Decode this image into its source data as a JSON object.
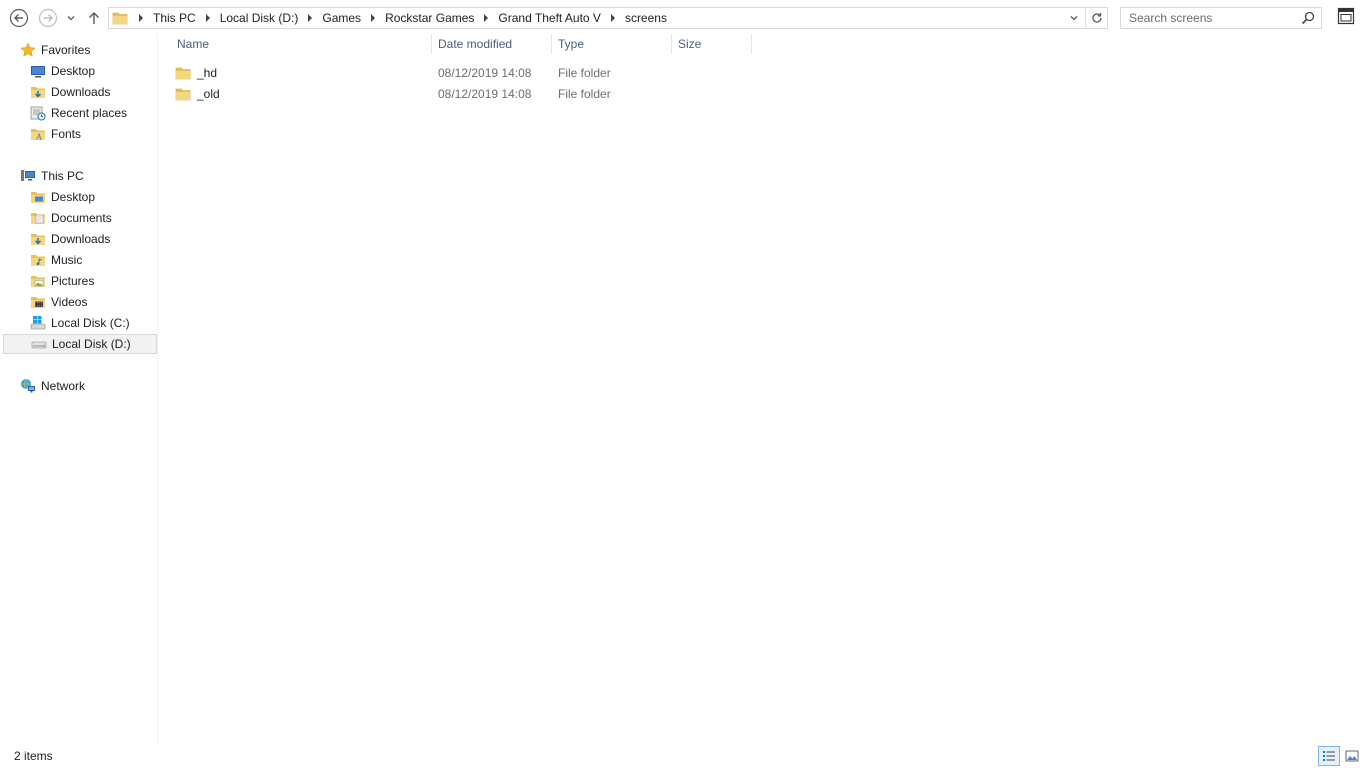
{
  "address": {
    "crumbs": [
      "This PC",
      "Local Disk (D:)",
      "Games",
      "Rockstar Games",
      "Grand Theft Auto V",
      "screens"
    ]
  },
  "search": {
    "placeholder": "Search screens"
  },
  "navpane": {
    "favorites": {
      "label": "Favorites",
      "items": [
        "Desktop",
        "Downloads",
        "Recent places",
        "Fonts"
      ]
    },
    "this_pc": {
      "label": "This PC",
      "items": [
        "Desktop",
        "Documents",
        "Downloads",
        "Music",
        "Pictures",
        "Videos",
        "Local Disk (C:)",
        "Local Disk (D:)"
      ]
    },
    "network": {
      "label": "Network"
    }
  },
  "columns": {
    "name": "Name",
    "date": "Date modified",
    "type": "Type",
    "size": "Size"
  },
  "files": [
    {
      "name": "_hd",
      "date": "08/12/2019 14:08",
      "type": "File folder",
      "size": ""
    },
    {
      "name": "_old",
      "date": "08/12/2019 14:08",
      "type": "File folder",
      "size": ""
    }
  ],
  "status": {
    "item_count": "2 items"
  },
  "colors": {
    "folder": "#e8c05a",
    "header_text": "#4c607a",
    "selection": "#f2f2f2",
    "accent": "#7eb4ea"
  }
}
